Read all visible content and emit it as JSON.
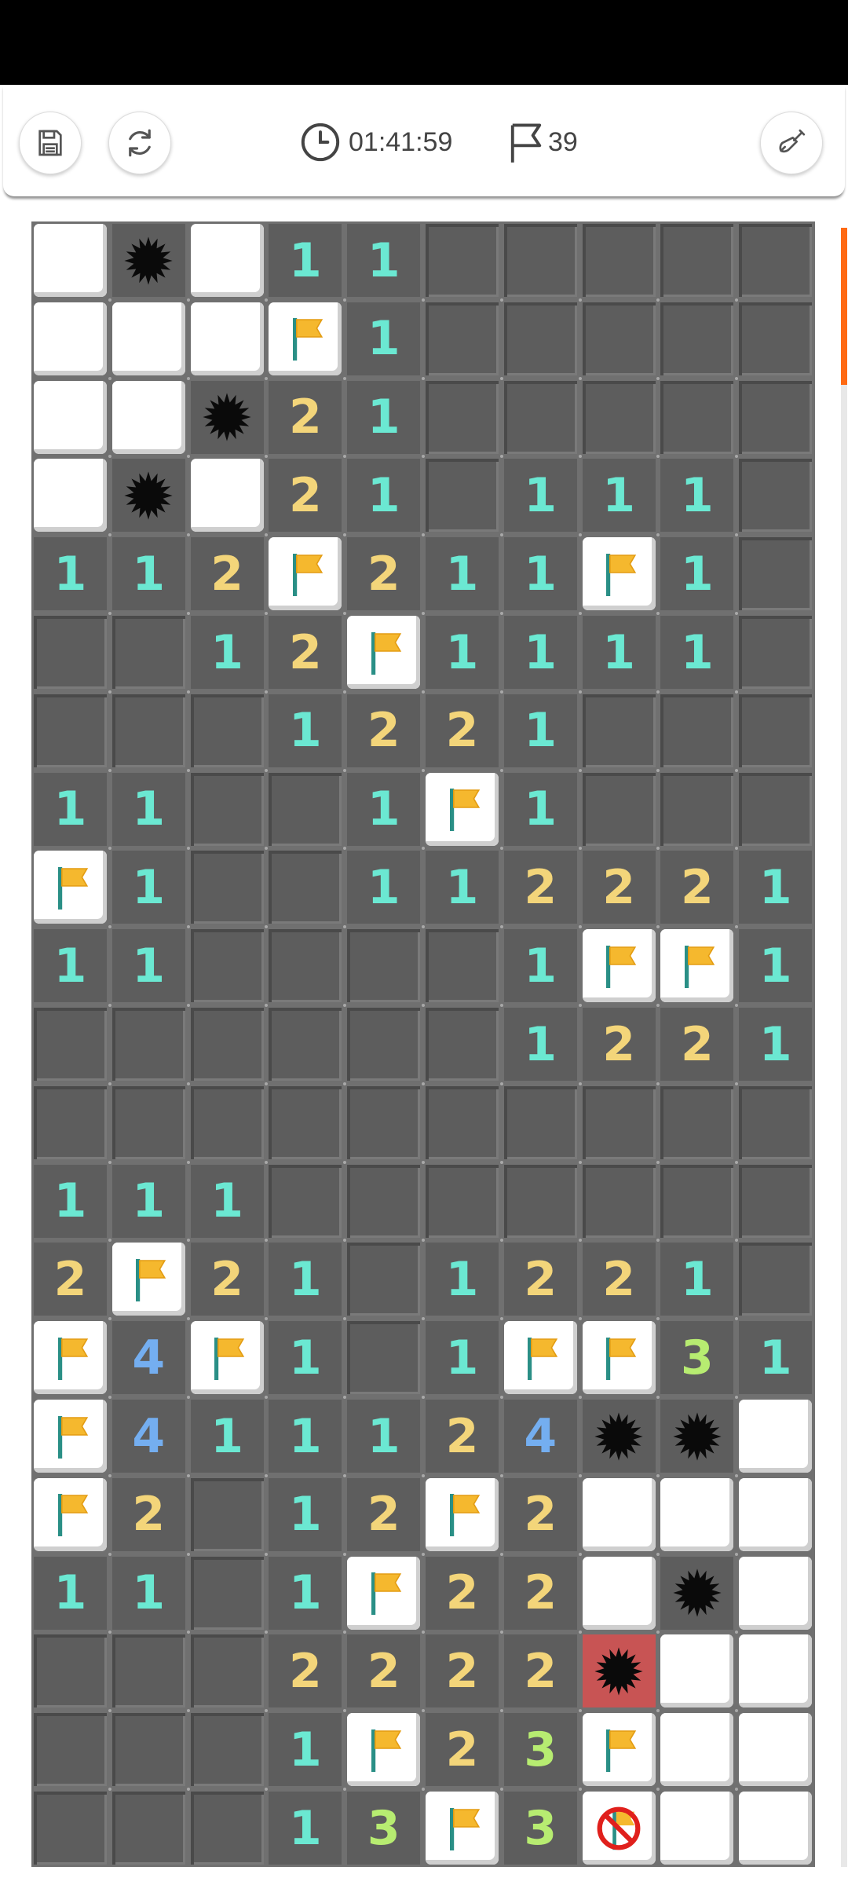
{
  "toolbar": {
    "timer": "01:41:59",
    "flags_remaining": "39",
    "icons": {
      "save": "floppy-disk-icon",
      "restart": "refresh-icon",
      "timer": "clock-icon",
      "flags": "flag-outline-icon",
      "mode": "shovel-icon"
    }
  },
  "board": {
    "legend": "w=revealed empty, h=hidden, f=flag, m=mine, e=exploded mine, x=wrong flag, 1-4=revealed number",
    "rows": [
      [
        "w",
        "m",
        "w",
        "1",
        "1",
        "h",
        "h",
        "h",
        "h",
        "h"
      ],
      [
        "w",
        "w",
        "w",
        "f",
        "1",
        "h",
        "h",
        "h",
        "h",
        "h"
      ],
      [
        "w",
        "w",
        "m",
        "2",
        "1",
        "h",
        "h",
        "h",
        "h",
        "h"
      ],
      [
        "w",
        "m",
        "w",
        "2",
        "1",
        "h",
        "1",
        "1",
        "1",
        "h"
      ],
      [
        "1",
        "1",
        "2",
        "f",
        "2",
        "1",
        "1",
        "f",
        "1",
        "h"
      ],
      [
        "h",
        "h",
        "1",
        "2",
        "f",
        "1",
        "1",
        "1",
        "1",
        "h"
      ],
      [
        "h",
        "h",
        "h",
        "1",
        "2",
        "2",
        "1",
        "h",
        "h",
        "h"
      ],
      [
        "1",
        "1",
        "h",
        "h",
        "1",
        "f",
        "1",
        "h",
        "h",
        "h"
      ],
      [
        "f",
        "1",
        "h",
        "h",
        "1",
        "1",
        "2",
        "2",
        "2",
        "1"
      ],
      [
        "1",
        "1",
        "h",
        "h",
        "h",
        "h",
        "1",
        "f",
        "f",
        "1"
      ],
      [
        "h",
        "h",
        "h",
        "h",
        "h",
        "h",
        "1",
        "2",
        "2",
        "1"
      ],
      [
        "h",
        "h",
        "h",
        "h",
        "h",
        "h",
        "h",
        "h",
        "h",
        "h"
      ],
      [
        "1",
        "1",
        "1",
        "h",
        "h",
        "h",
        "h",
        "h",
        "h",
        "h"
      ],
      [
        "2",
        "f",
        "2",
        "1",
        "h",
        "1",
        "2",
        "2",
        "1",
        "h"
      ],
      [
        "f",
        "4",
        "f",
        "1",
        "h",
        "1",
        "f",
        "f",
        "3",
        "1"
      ],
      [
        "f",
        "4",
        "1",
        "1",
        "1",
        "2",
        "4",
        "m",
        "m",
        "w"
      ],
      [
        "f",
        "2",
        "h",
        "1",
        "2",
        "f",
        "2",
        "w",
        "w",
        "w"
      ],
      [
        "1",
        "1",
        "h",
        "1",
        "f",
        "2",
        "2",
        "w",
        "m",
        "w"
      ],
      [
        "h",
        "h",
        "h",
        "2",
        "2",
        "2",
        "2",
        "e",
        "w",
        "w"
      ],
      [
        "h",
        "h",
        "h",
        "1",
        "f",
        "2",
        "3",
        "f",
        "w",
        "w"
      ],
      [
        "h",
        "h",
        "h",
        "1",
        "3",
        "f",
        "3",
        "x",
        "w",
        "w"
      ]
    ]
  },
  "colors": {
    "hidden": "#5d5d5d",
    "board_bg": "#707070",
    "num1": "#6be8d2",
    "num2": "#f3d57a",
    "num3": "#b7ec71",
    "num4": "#74aef0",
    "exploded": "#c85454",
    "scroll_accent": "#ff6a13"
  }
}
